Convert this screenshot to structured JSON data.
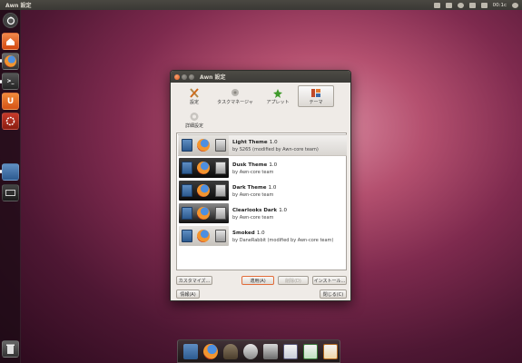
{
  "top_panel": {
    "title": "Awn 設定",
    "clock": "00:1c",
    "tray_icons": [
      "keyboard-icon",
      "mail-icon",
      "network-icon",
      "volume-icon",
      "battery-icon"
    ],
    "power_icon": "gear-icon"
  },
  "launcher": {
    "items": [
      "dash-icon",
      "home-folder-icon",
      "firefox-icon",
      "terminal-icon",
      "ubuntu-one-icon",
      "software-center-icon",
      "awn-settings-icon",
      "workspace-icon"
    ],
    "trash_icon": "trash-icon"
  },
  "window": {
    "title": "Awn 設定",
    "toolbar": [
      {
        "label": "設定",
        "icon": "tools-icon"
      },
      {
        "label": "タスクマネージャ",
        "icon": "task-manager-icon"
      },
      {
        "label": "アプレット",
        "icon": "applet-icon"
      },
      {
        "label": "テーマ",
        "icon": "theme-icon"
      },
      {
        "label": "詳細設定",
        "icon": "advanced-icon"
      }
    ],
    "active_tab": "テーマ",
    "themes": [
      {
        "name": "Light Theme",
        "version": "1.0",
        "author": "by S265 (modified by Awn-core team)",
        "style": "light",
        "selected": true
      },
      {
        "name": "Dusk Theme",
        "version": "1.0",
        "author": "by Awn-core team",
        "style": "dark",
        "selected": false
      },
      {
        "name": "Dark Theme",
        "version": "1.0",
        "author": "by Awn-core team",
        "style": "dark",
        "selected": false
      },
      {
        "name": "Clearlooks Dark",
        "version": "1.0",
        "author": "by Awn-core team",
        "style": "clear",
        "selected": false
      },
      {
        "name": "Smoked",
        "version": "1.0",
        "author": "by DaneRabbit (modified by Awn-core team)",
        "style": "light",
        "selected": false
      }
    ],
    "buttons": {
      "customize": "カスタマイズ...",
      "apply": "適用(A)",
      "delete": "削除(D)",
      "install": "インストール...",
      "about": "情報(A)",
      "close": "閉じる(C)"
    }
  },
  "dock": {
    "items": [
      "disk-icon",
      "firefox-icon",
      "gimp-icon",
      "inkscape-icon",
      "media-icon",
      "document-icon",
      "spreadsheet-icon",
      "presentation-icon"
    ]
  }
}
